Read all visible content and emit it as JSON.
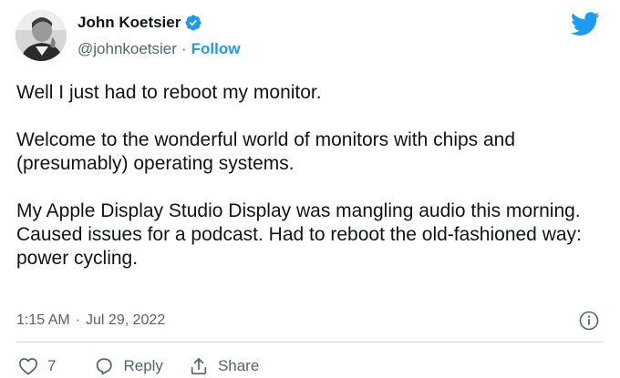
{
  "author": {
    "name": "John Koetsier",
    "handle": "@johnkoetsier",
    "separator": "·",
    "follow_label": "Follow"
  },
  "tweet": {
    "paragraphs": [
      "Well I just had to reboot my monitor.",
      "Welcome to the wonderful world of monitors with chips and (presumably) operating systems.",
      "My Apple Display Studio Display was mangling audio this morning. Caused issues for a podcast. Had to reboot the old-fashioned way: power cycling."
    ],
    "time": "1:15 AM",
    "date": "Jul 29, 2022",
    "meta_separator": "·"
  },
  "actions": {
    "like_count": "7",
    "reply_label": "Reply",
    "share_label": "Share"
  },
  "icons": {
    "verified": "verified-badge-icon",
    "brand": "twitter-bird-icon",
    "info": "info-icon",
    "like": "heart-icon",
    "reply": "reply-bubble-icon",
    "share": "share-upload-icon"
  },
  "colors": {
    "accent": "#1d9bf0",
    "text": "#0f1419",
    "muted": "#536471",
    "divider": "#cfd9de"
  }
}
